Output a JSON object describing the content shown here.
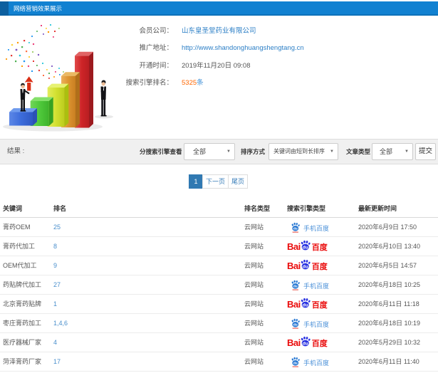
{
  "header": {
    "title": "网络营销效果展示"
  },
  "info": {
    "rows": [
      {
        "label": "会员公司：",
        "value": "山东皇圣堂药业有限公司",
        "style": "link"
      },
      {
        "label": "推广地址：",
        "value": "http://www.shandonghuangshengtang.cn",
        "style": "link"
      },
      {
        "label": "开通时间：",
        "value": "2019年11月20日 09:08",
        "style": "plain"
      },
      {
        "label": "搜索引擎排名：",
        "value": "5325",
        "suffix": "条",
        "style": "rank"
      }
    ]
  },
  "filters": {
    "result_label": "结果 :",
    "engine_label": "分搜索引擎查看",
    "engine_value": "全部",
    "sort_label": "排序方式",
    "sort_value": "关键词由短到长排序",
    "article_label": "文章类型",
    "article_value": "全部",
    "submit_label": "提交"
  },
  "pagination": {
    "current": "1",
    "next": "下一页",
    "last": "尾页"
  },
  "baidu_logo": {
    "latin": "Bai",
    "paw_du": "du",
    "cn": "百度"
  },
  "table": {
    "headers": [
      "关键词",
      "排名",
      "排名类型",
      "搜索引擎类型",
      "最新更新时间"
    ],
    "rows": [
      {
        "keyword": "膏药OEM",
        "rank": "25",
        "rank_type": "云网站",
        "engine": "mobile",
        "engine_label": "手机百度",
        "updated": "2020年6月9日 17:50"
      },
      {
        "keyword": "膏药代加工",
        "rank": "8",
        "rank_type": "云网站",
        "engine": "baidu",
        "engine_label": "百度",
        "updated": "2020年6月10日 13:40"
      },
      {
        "keyword": "OEM代加工",
        "rank": "9",
        "rank_type": "云网站",
        "engine": "baidu",
        "engine_label": "百度",
        "updated": "2020年6月5日 14:57"
      },
      {
        "keyword": "药贴牌代加工",
        "rank": "27",
        "rank_type": "云网站",
        "engine": "mobile",
        "engine_label": "手机百度",
        "updated": "2020年6月18日 10:25"
      },
      {
        "keyword": "北京膏药贴牌",
        "rank": "1",
        "rank_type": "云网站",
        "engine": "baidu",
        "engine_label": "百度",
        "updated": "2020年6月11日 11:18"
      },
      {
        "keyword": "枣庄膏药加工",
        "rank": "1,4,6",
        "rank_type": "云网站",
        "engine": "mobile",
        "engine_label": "手机百度",
        "updated": "2020年6月18日 10:19"
      },
      {
        "keyword": "医疗器械厂家",
        "rank": "4",
        "rank_type": "云网站",
        "engine": "baidu",
        "engine_label": "百度",
        "updated": "2020年5月29日 10:32"
      },
      {
        "keyword": "菏泽膏药厂家",
        "rank": "17",
        "rank_type": "云网站",
        "engine": "mobile",
        "engine_label": "手机百度",
        "updated": "2020年6月11日 11:40"
      }
    ]
  }
}
